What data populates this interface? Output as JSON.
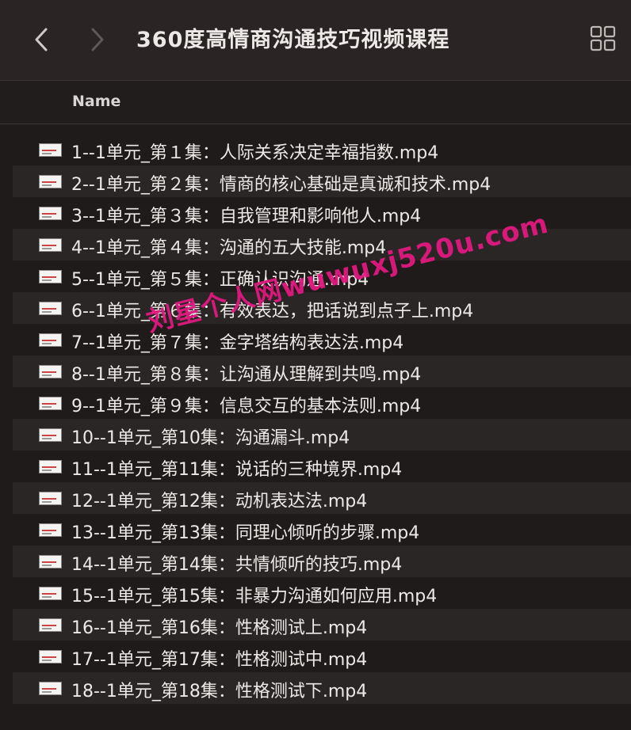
{
  "window": {
    "title": "360度高情商沟通技巧视频课程"
  },
  "toolbar": {
    "back_icon": "chevron-left-icon",
    "forward_icon": "chevron-right-icon",
    "view_icon": "grid-view-icon"
  },
  "columns": {
    "name": "Name"
  },
  "files": [
    "1--1单元_第１集：人际关系决定幸福指数.mp4",
    "2--1单元_第２集：情商的核心基础是真诚和技术.mp4",
    "3--1单元_第３集：自我管理和影响他人.mp4",
    "4--1单元_第４集：沟通的五大技能.mp4",
    "5--1单元_第５集：正确认识沟通.mp4",
    "6--1单元_第６集：有效表达，把话说到点子上.mp4",
    "7--1单元_第７集：金字塔结构表达法.mp4",
    "8--1单元_第８集：让沟通从理解到共鸣.mp4",
    "9--1单元_第９集：信息交互的基本法则.mp4",
    "10--1单元_第10集：沟通漏斗.mp4",
    "11--1单元_第11集：说话的三种境界.mp4",
    "12--1单元_第12集：动机表达法.mp4",
    "13--1单元_第13集：同理心倾听的步骤.mp4",
    "14--1单元_第14集：共情倾听的技巧.mp4",
    "15--1单元_第15集：非暴力沟通如何应用.mp4",
    "16--1单元_第16集：性格测试上.mp4",
    "17--1单元_第17集：性格测试中.mp4",
    "18--1单元_第18集：性格测试下.mp4"
  ],
  "watermark": "刘星个人网wuwuxj520u.com"
}
